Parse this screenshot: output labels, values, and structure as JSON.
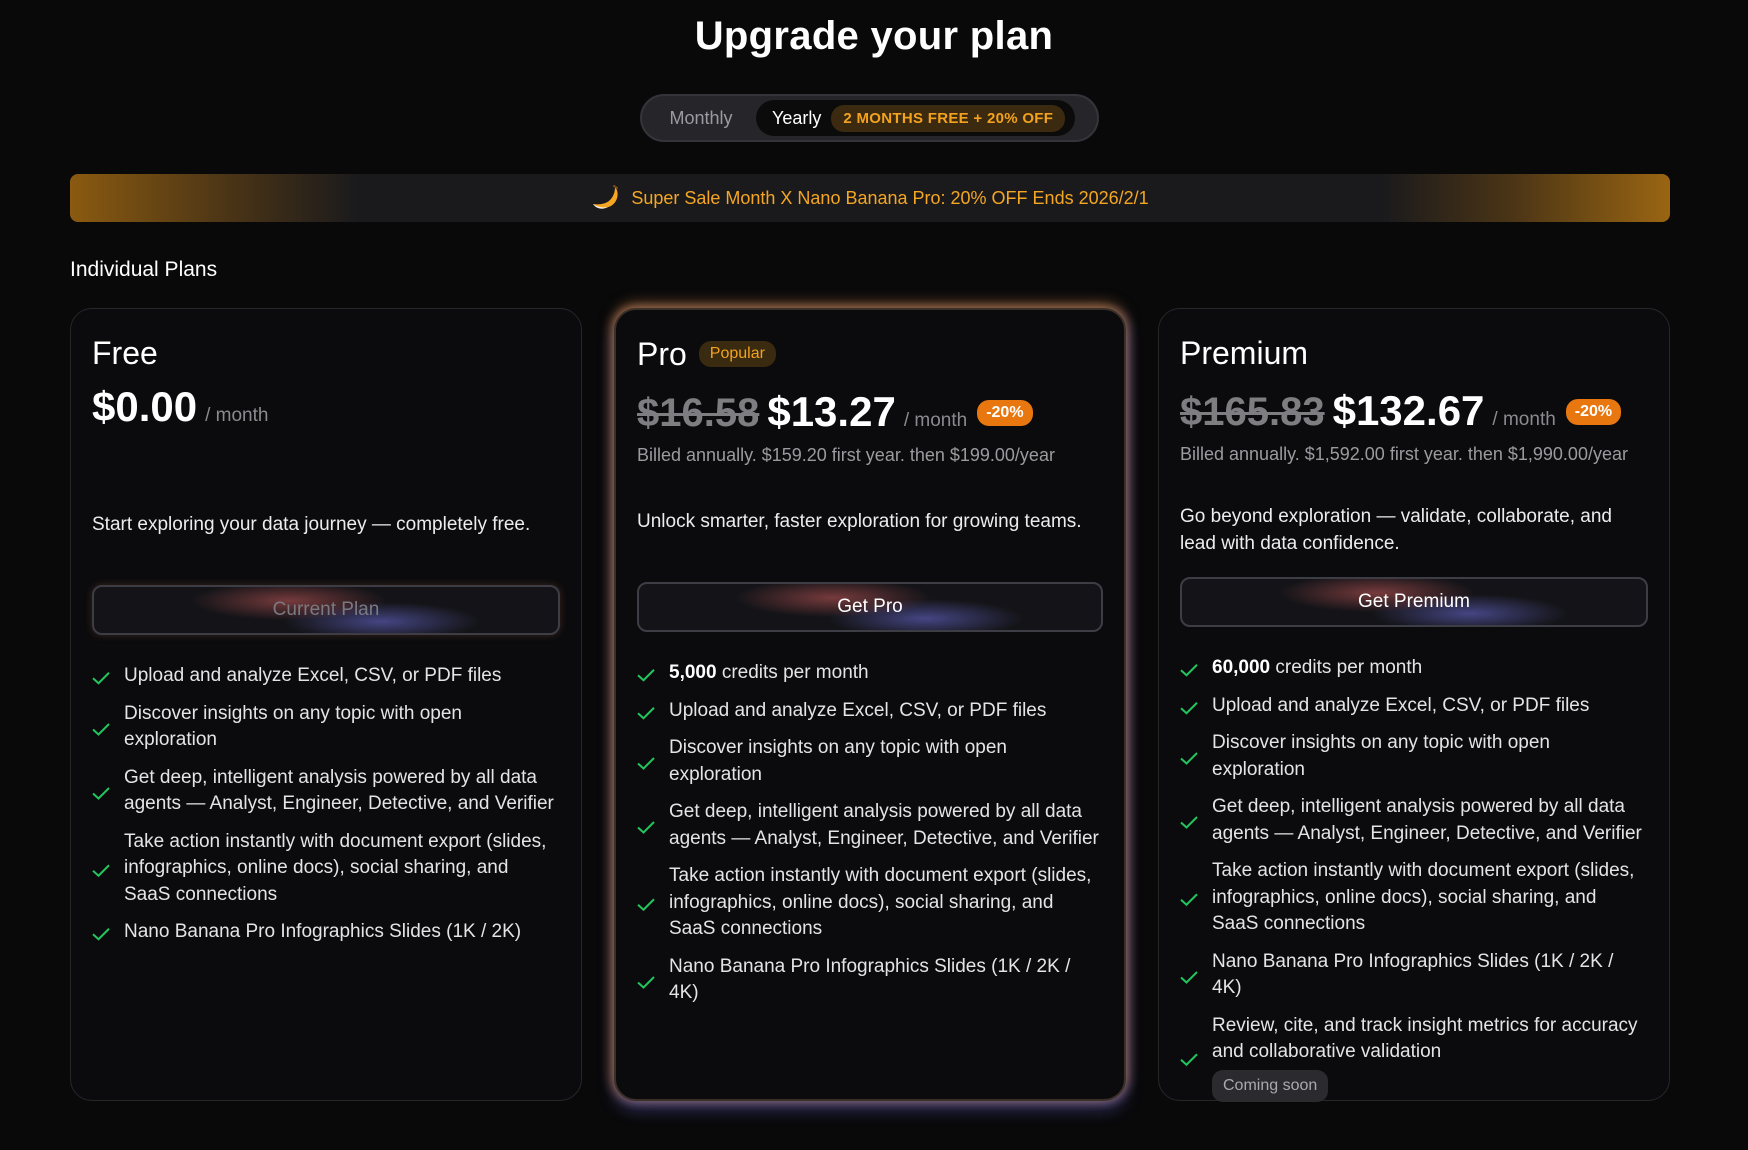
{
  "header": {
    "title": "Upgrade your plan"
  },
  "billing_toggle": {
    "monthly_label": "Monthly",
    "yearly_label": "Yearly",
    "yearly_badge": "2 MONTHS FREE + 20% OFF",
    "selected": "Yearly"
  },
  "sale_banner": {
    "text": "Super Sale Month X Nano Banana Pro: 20% OFF Ends 2026/2/1",
    "icon": "banana-icon"
  },
  "section_label": "Individual Plans",
  "colors": {
    "accent_orange": "#f5a623",
    "check_green": "#22c55e",
    "discount_orange": "#e8770f"
  },
  "plans": {
    "free": {
      "name": "Free",
      "price": "$0.00",
      "per": "/ month",
      "description": "Start exploring your data journey — completely free.",
      "cta": "Current Plan",
      "features": [
        "Upload and analyze Excel, CSV, or PDF files",
        "Discover insights on any topic with open exploration",
        "Get deep, intelligent analysis powered by all data agents — Analyst, Engineer, Detective, and Verifier",
        "Take action instantly with document export (slides, infographics, online docs), social sharing, and SaaS connections",
        "Nano Banana Pro Infographics Slides (1K / 2K)"
      ]
    },
    "pro": {
      "name": "Pro",
      "badge": "Popular",
      "old_price": "$16.58",
      "price": "$13.27",
      "per": "/ month",
      "discount": "-20%",
      "billed": "Billed annually. $159.20 first year. then $199.00/year",
      "description": "Unlock smarter, faster exploration for growing teams.",
      "cta": "Get Pro",
      "credits_amount": "5,000",
      "credits_text": " credits per month",
      "features": [
        "Upload and analyze Excel, CSV, or PDF files",
        "Discover insights on any topic with open exploration",
        "Get deep, intelligent analysis powered by all data agents — Analyst, Engineer, Detective, and Verifier",
        "Take action instantly with document export (slides, infographics, online docs), social sharing, and SaaS connections",
        "Nano Banana Pro Infographics Slides (1K / 2K / 4K)"
      ]
    },
    "premium": {
      "name": "Premium",
      "old_price": "$165.83",
      "price": "$132.67",
      "per": "/ month",
      "discount": "-20%",
      "billed": "Billed annually. $1,592.00 first year. then $1,990.00/year",
      "description": "Go beyond exploration — validate, collaborate, and lead with data confidence.",
      "cta": "Get Premium",
      "credits_amount": "60,000",
      "credits_text": " credits per month",
      "features": [
        "Upload and analyze Excel, CSV, or PDF files",
        "Discover insights on any topic with open exploration",
        "Get deep, intelligent analysis powered by all data agents — Analyst, Engineer, Detective, and Verifier",
        "Take action instantly with document export (slides, infographics, online docs), social sharing, and SaaS connections",
        "Nano Banana Pro Infographics Slides (1K / 2K / 4K)",
        "Review, cite, and track insight metrics for accuracy and collaborative validation"
      ],
      "coming_soon": "Coming soon"
    }
  }
}
